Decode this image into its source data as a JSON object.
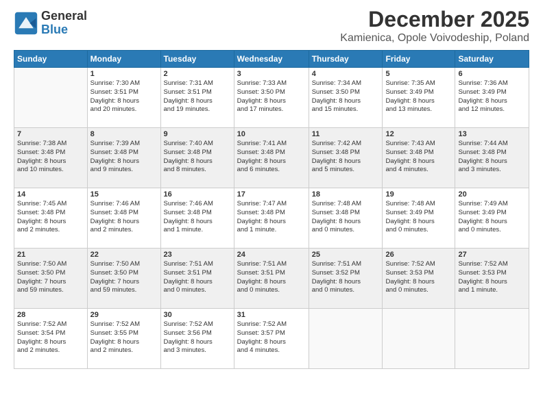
{
  "logo": {
    "general": "General",
    "blue": "Blue"
  },
  "header": {
    "month": "December 2025",
    "location": "Kamienica, Opole Voivodeship, Poland"
  },
  "days": [
    "Sunday",
    "Monday",
    "Tuesday",
    "Wednesday",
    "Thursday",
    "Friday",
    "Saturday"
  ],
  "weeks": [
    [
      {
        "day": "",
        "text": ""
      },
      {
        "day": "1",
        "text": "Sunrise: 7:30 AM\nSunset: 3:51 PM\nDaylight: 8 hours\nand 20 minutes."
      },
      {
        "day": "2",
        "text": "Sunrise: 7:31 AM\nSunset: 3:51 PM\nDaylight: 8 hours\nand 19 minutes."
      },
      {
        "day": "3",
        "text": "Sunrise: 7:33 AM\nSunset: 3:50 PM\nDaylight: 8 hours\nand 17 minutes."
      },
      {
        "day": "4",
        "text": "Sunrise: 7:34 AM\nSunset: 3:50 PM\nDaylight: 8 hours\nand 15 minutes."
      },
      {
        "day": "5",
        "text": "Sunrise: 7:35 AM\nSunset: 3:49 PM\nDaylight: 8 hours\nand 13 minutes."
      },
      {
        "day": "6",
        "text": "Sunrise: 7:36 AM\nSunset: 3:49 PM\nDaylight: 8 hours\nand 12 minutes."
      }
    ],
    [
      {
        "day": "7",
        "text": "Sunrise: 7:38 AM\nSunset: 3:48 PM\nDaylight: 8 hours\nand 10 minutes."
      },
      {
        "day": "8",
        "text": "Sunrise: 7:39 AM\nSunset: 3:48 PM\nDaylight: 8 hours\nand 9 minutes."
      },
      {
        "day": "9",
        "text": "Sunrise: 7:40 AM\nSunset: 3:48 PM\nDaylight: 8 hours\nand 8 minutes."
      },
      {
        "day": "10",
        "text": "Sunrise: 7:41 AM\nSunset: 3:48 PM\nDaylight: 8 hours\nand 6 minutes."
      },
      {
        "day": "11",
        "text": "Sunrise: 7:42 AM\nSunset: 3:48 PM\nDaylight: 8 hours\nand 5 minutes."
      },
      {
        "day": "12",
        "text": "Sunrise: 7:43 AM\nSunset: 3:48 PM\nDaylight: 8 hours\nand 4 minutes."
      },
      {
        "day": "13",
        "text": "Sunrise: 7:44 AM\nSunset: 3:48 PM\nDaylight: 8 hours\nand 3 minutes."
      }
    ],
    [
      {
        "day": "14",
        "text": "Sunrise: 7:45 AM\nSunset: 3:48 PM\nDaylight: 8 hours\nand 2 minutes."
      },
      {
        "day": "15",
        "text": "Sunrise: 7:46 AM\nSunset: 3:48 PM\nDaylight: 8 hours\nand 2 minutes."
      },
      {
        "day": "16",
        "text": "Sunrise: 7:46 AM\nSunset: 3:48 PM\nDaylight: 8 hours\nand 1 minute."
      },
      {
        "day": "17",
        "text": "Sunrise: 7:47 AM\nSunset: 3:48 PM\nDaylight: 8 hours\nand 1 minute."
      },
      {
        "day": "18",
        "text": "Sunrise: 7:48 AM\nSunset: 3:48 PM\nDaylight: 8 hours\nand 0 minutes."
      },
      {
        "day": "19",
        "text": "Sunrise: 7:48 AM\nSunset: 3:49 PM\nDaylight: 8 hours\nand 0 minutes."
      },
      {
        "day": "20",
        "text": "Sunrise: 7:49 AM\nSunset: 3:49 PM\nDaylight: 8 hours\nand 0 minutes."
      }
    ],
    [
      {
        "day": "21",
        "text": "Sunrise: 7:50 AM\nSunset: 3:50 PM\nDaylight: 7 hours\nand 59 minutes."
      },
      {
        "day": "22",
        "text": "Sunrise: 7:50 AM\nSunset: 3:50 PM\nDaylight: 7 hours\nand 59 minutes."
      },
      {
        "day": "23",
        "text": "Sunrise: 7:51 AM\nSunset: 3:51 PM\nDaylight: 8 hours\nand 0 minutes."
      },
      {
        "day": "24",
        "text": "Sunrise: 7:51 AM\nSunset: 3:51 PM\nDaylight: 8 hours\nand 0 minutes."
      },
      {
        "day": "25",
        "text": "Sunrise: 7:51 AM\nSunset: 3:52 PM\nDaylight: 8 hours\nand 0 minutes."
      },
      {
        "day": "26",
        "text": "Sunrise: 7:52 AM\nSunset: 3:53 PM\nDaylight: 8 hours\nand 0 minutes."
      },
      {
        "day": "27",
        "text": "Sunrise: 7:52 AM\nSunset: 3:53 PM\nDaylight: 8 hours\nand 1 minute."
      }
    ],
    [
      {
        "day": "28",
        "text": "Sunrise: 7:52 AM\nSunset: 3:54 PM\nDaylight: 8 hours\nand 2 minutes."
      },
      {
        "day": "29",
        "text": "Sunrise: 7:52 AM\nSunset: 3:55 PM\nDaylight: 8 hours\nand 2 minutes."
      },
      {
        "day": "30",
        "text": "Sunrise: 7:52 AM\nSunset: 3:56 PM\nDaylight: 8 hours\nand 3 minutes."
      },
      {
        "day": "31",
        "text": "Sunrise: 7:52 AM\nSunset: 3:57 PM\nDaylight: 8 hours\nand 4 minutes."
      },
      {
        "day": "",
        "text": ""
      },
      {
        "day": "",
        "text": ""
      },
      {
        "day": "",
        "text": ""
      }
    ]
  ]
}
